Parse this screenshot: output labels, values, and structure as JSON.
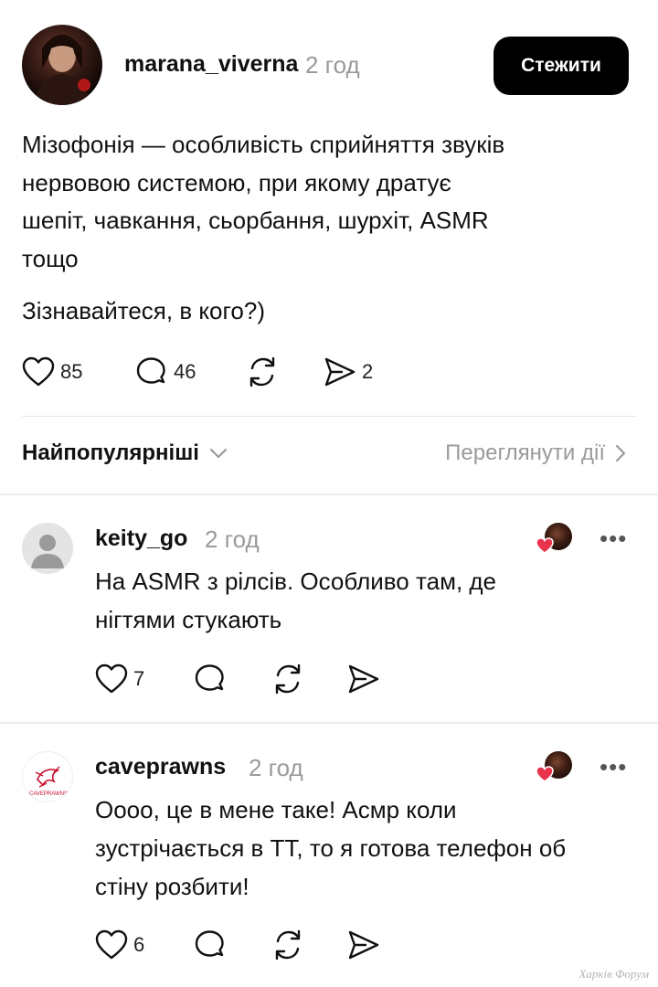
{
  "post": {
    "username": "marana_viverna",
    "time": "2 год",
    "follow_label": "Стежити",
    "text_lines": [
      "Мізофонія — особливість сприйняття звуків",
      "нервовою системою, при якому дратує",
      "шепіт, чавкання, сьорбання, шурхіт, ASMR",
      "тощо"
    ],
    "text2": "Зізнавайтеся, в кого?)",
    "likes": "85",
    "comments": "46",
    "shares": "2"
  },
  "sort": {
    "label": "Найпопулярніші",
    "activity_label": "Переглянути дії"
  },
  "comments": [
    {
      "username": "keity_go",
      "time": "2 год",
      "text_lines": [
        "На ASMR з рілсів. Особливо там, де",
        "нігтями стукають"
      ],
      "likes": "7",
      "more": "•••"
    },
    {
      "username": "caveprawns",
      "time": "2 год",
      "text_lines": [
        "Оооо, це в мене таке! Асмр коли",
        "зустрічається в ТТ, то я готова телефон об",
        "стіну розбити!"
      ],
      "likes": "6",
      "more": "•••",
      "avatar_text": "CAVEPRAWNS"
    }
  ],
  "watermark": "Харків Форум",
  "colors": {
    "accent": "#000000",
    "muted": "#9a9a9a",
    "heart": "#e8334a"
  }
}
